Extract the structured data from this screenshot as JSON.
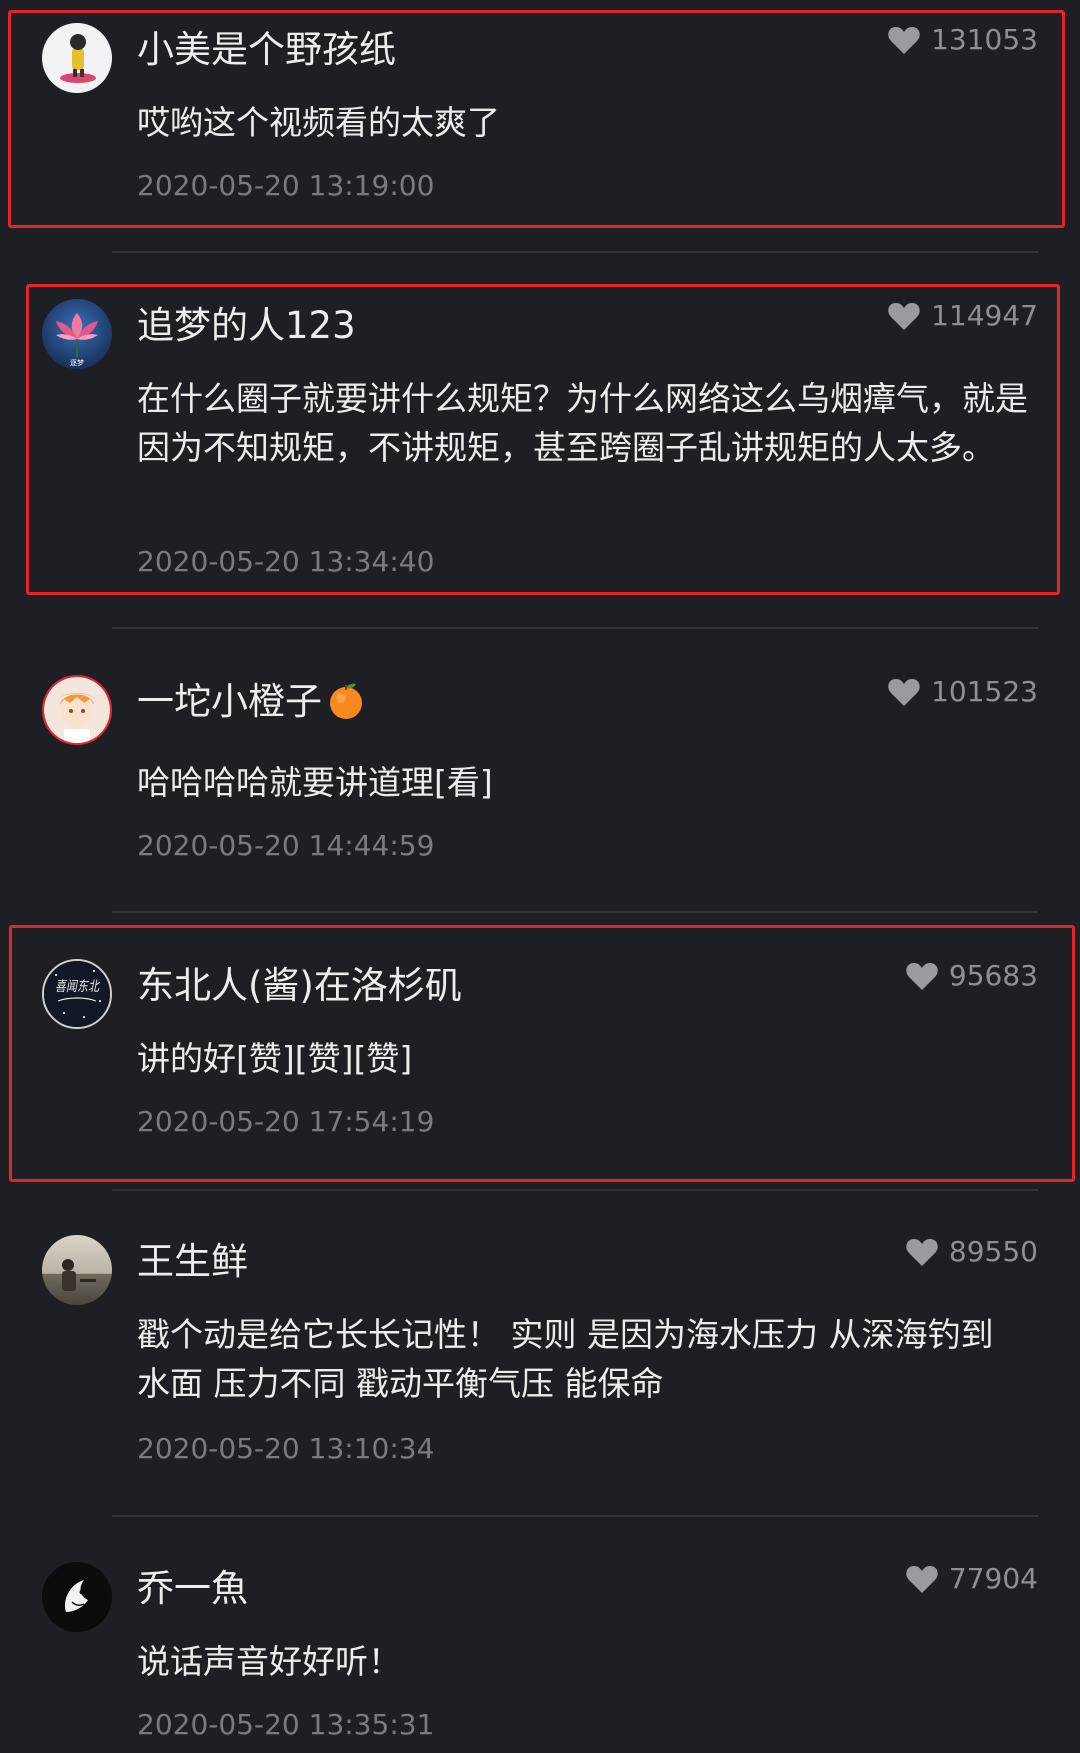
{
  "comments": [
    {
      "username": "小美是个野孩纸",
      "likes": "131053",
      "content": "哎哟这个视频看的太爽了",
      "time": "2020-05-20 13:19:00",
      "highlighted": true
    },
    {
      "username": "追梦的人123",
      "likes": "114947",
      "content": "在什么圈子就要讲什么规矩？为什么网络这么乌烟瘴气，就是因为不知规矩，不讲规矩，甚至跨圈子乱讲规矩的人太多。",
      "time": "2020-05-20 13:34:40",
      "highlighted": true
    },
    {
      "username": "一坨小橙子",
      "likes": "101523",
      "content": "哈哈哈哈就要讲道理[看]",
      "time": "2020-05-20 14:44:59",
      "highlighted": false
    },
    {
      "username": "东北人(酱)在洛杉矶",
      "likes": "95683",
      "content": "讲的好[赞][赞][赞]",
      "time": "2020-05-20 17:54:19",
      "highlighted": true
    },
    {
      "username": "王生鲜",
      "likes": "89550",
      "content": "戳个动是给它长长记性！ 实则 是因为海水压力 从深海钓到水面 压力不同 戳动平衡气压 能保命",
      "time": "2020-05-20 13:10:34",
      "highlighted": false
    },
    {
      "username": "乔一魚",
      "likes": "77904",
      "content": "说话声音好好听！",
      "time": "2020-05-20 13:35:31",
      "highlighted": false
    }
  ],
  "avatar_texts": {
    "avatar_2": "逐梦",
    "avatar_4": "喜闻东北"
  },
  "icons": {
    "like": "heart-icon",
    "emoji": "orange-emoji-icon"
  },
  "colors": {
    "background": "#1e1f24",
    "highlight_border": "#e0262b",
    "like_color": "#8e8f94",
    "time_color": "#7a7b80"
  }
}
